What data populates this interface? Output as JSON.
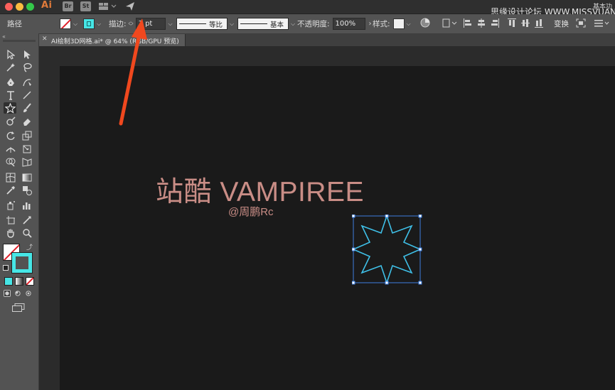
{
  "menubar": {
    "app_icon_label": "Ai",
    "bridge_label": "Br",
    "stock_label": "St",
    "watermark": "思缘设计论坛 WWW.MISSVUAN.COM",
    "workspace_label": "基本功"
  },
  "control_bar": {
    "object_type": "路径",
    "stroke_label": "描边:",
    "stroke_weight": "3 pt",
    "variable_width_profile": "等比",
    "brush_definition": "基本",
    "opacity_label": "不透明度:",
    "opacity_value": "100%",
    "style_label": "样式:",
    "transform_label": "变换",
    "fill_color": "none",
    "stroke_color": "#46e6e6"
  },
  "document_tab": {
    "title": "AI绘制3D网格.ai* @ 64% (RGB/GPU 预览)"
  },
  "artboard": {
    "title_text": "站酷 VAMPIREE",
    "author_text": "@周鹏Rc",
    "text_color": "#c98d86",
    "star_stroke_color": "#3fc0e8",
    "selection_color": "#3d7fe0"
  },
  "annotation": {
    "arrow_color": "#f0481e"
  }
}
